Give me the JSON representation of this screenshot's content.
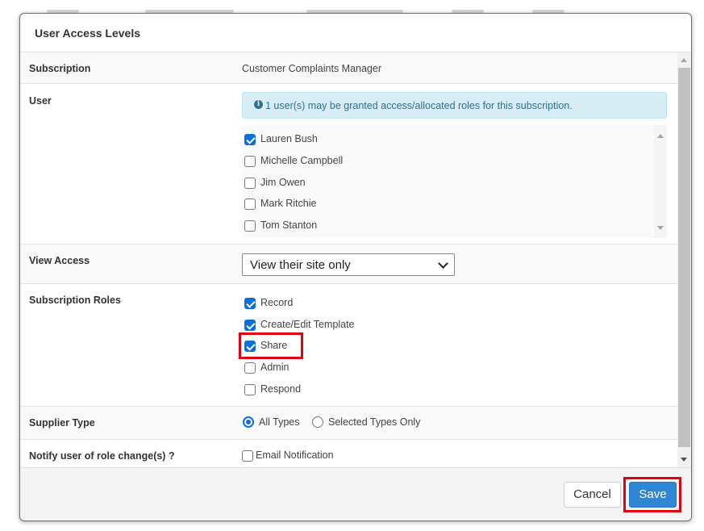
{
  "dialog": {
    "title": "User Access Levels"
  },
  "subscription": {
    "label": "Subscription",
    "value": "Customer Complaints Manager"
  },
  "user": {
    "label": "User",
    "info_text": "1 user(s) may be granted access/allocated roles for this subscription.",
    "info_icon": "info-circle-icon",
    "users": [
      {
        "name": "Lauren Bush",
        "checked": true
      },
      {
        "name": "Michelle Campbell",
        "checked": false
      },
      {
        "name": "Jim Owen",
        "checked": false
      },
      {
        "name": "Mark Ritchie",
        "checked": false
      },
      {
        "name": "Tom Stanton",
        "checked": false
      }
    ]
  },
  "view_access": {
    "label": "View Access",
    "selected": "View their site only"
  },
  "roles": {
    "label": "Subscription Roles",
    "items": [
      {
        "name": "Record",
        "checked": true
      },
      {
        "name": "Create/Edit Template",
        "checked": true
      },
      {
        "name": "Share",
        "checked": true
      },
      {
        "name": "Admin",
        "checked": false
      },
      {
        "name": "Respond",
        "checked": false
      }
    ]
  },
  "supplier_type": {
    "label": "Supplier Type",
    "options": [
      {
        "name": "All Types",
        "selected": true
      },
      {
        "name": "Selected Types Only",
        "selected": false
      }
    ]
  },
  "notify": {
    "label": "Notify user of role change(s) ?",
    "option": "Email Notification",
    "checked": false
  },
  "footer": {
    "cancel_label": "Cancel",
    "save_label": "Save"
  },
  "colors": {
    "accent": "#2f86d4",
    "highlight": "#e0000f",
    "info_bg": "#d9edf7",
    "info_text": "#31708f"
  }
}
